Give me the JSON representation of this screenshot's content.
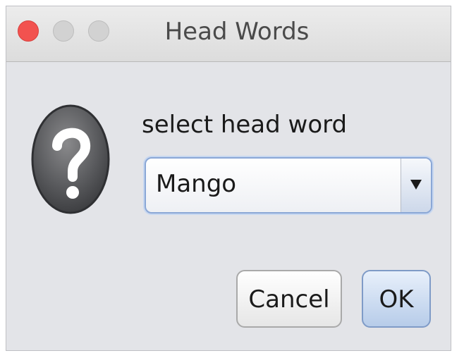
{
  "window": {
    "title": "Head Words",
    "controls": {
      "close_color": "#f2524f",
      "inactive_color": "#d2d2d2"
    }
  },
  "dialog": {
    "icon": "question-mark-icon",
    "prompt": "select head word",
    "combo": {
      "selected": "Mango"
    },
    "buttons": {
      "cancel_label": "Cancel",
      "ok_label": "OK"
    }
  }
}
